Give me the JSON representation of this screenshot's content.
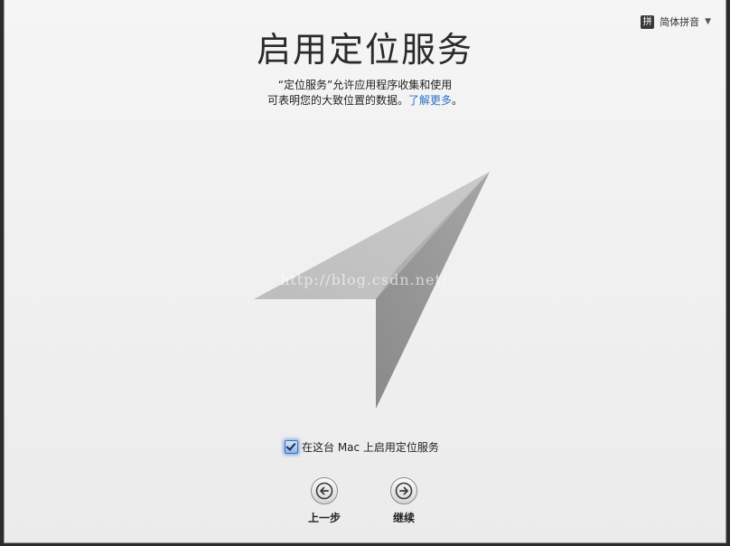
{
  "input_menu": {
    "icon_glyph": "拼",
    "label": "简体拼音",
    "caret": "▼"
  },
  "page": {
    "title": "启用定位服务",
    "description_line1": "“定位服务”允许应用程序收集和使用",
    "description_line2": "可表明您的大致位置的数据。",
    "learn_more": "了解更多",
    "description_end": "。"
  },
  "watermark": "http://blog.csdn.net/",
  "enable": {
    "checked": true,
    "label": "在这台 Mac 上启用定位服务"
  },
  "navigation": {
    "back_label": "上一步",
    "next_label": "继续"
  },
  "colors": {
    "link": "#2f72c2",
    "checkbox_focus": "#5f96e6",
    "arrow_light": "#bdbdbd",
    "arrow_dark": "#8e8e8e"
  }
}
